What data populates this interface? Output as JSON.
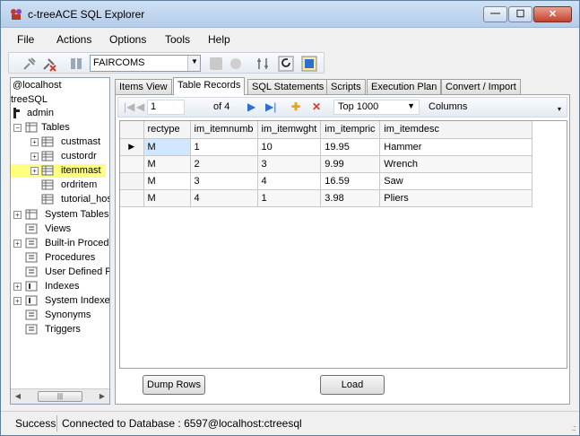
{
  "window": {
    "title": "c-treeACE SQL Explorer"
  },
  "menu": [
    "File",
    "Actions",
    "Options",
    "Tools",
    "Help"
  ],
  "toolbar": {
    "database": "FAIRCOMS"
  },
  "tree": {
    "server": "@localhost",
    "database": "treeSQL",
    "user": "admin",
    "tables_label": "Tables",
    "tables": [
      "custmast",
      "custordr",
      "itemmast",
      "ordritem",
      "tutorial_hos"
    ],
    "selected": "itemmast",
    "groups": [
      "System Tables",
      "Views",
      "Built-in Procedu",
      "Procedures",
      "User Defined F",
      "Indexes",
      "System Indexes",
      "Synonyms",
      "Triggers"
    ]
  },
  "tabs": [
    "Items View",
    "Table Records",
    "SQL Statements",
    "Scripts",
    "Execution Plan",
    "Convert / Import"
  ],
  "active_tab": "Table Records",
  "navigator": {
    "position": "1",
    "of_label": "of 4",
    "top_value": "Top 1000",
    "columns_label": "Columns"
  },
  "grid": {
    "columns": [
      "rectype",
      "im_itemnumb",
      "im_itemwght",
      "im_itempric",
      "im_itemdesc"
    ],
    "rows": [
      [
        "M",
        "1",
        "10",
        "19.95",
        "Hammer"
      ],
      [
        "M",
        "2",
        "3",
        "9.99",
        "Wrench"
      ],
      [
        "M",
        "3",
        "4",
        "16.59",
        "Saw"
      ],
      [
        "M",
        "4",
        "1",
        "3.98",
        "Pliers"
      ]
    ]
  },
  "buttons": {
    "dump": "Dump Rows",
    "load": "Load"
  },
  "status": {
    "state": "Success",
    "message": "Connected to Database : 6597@localhost:ctreesql"
  },
  "icons": {
    "app": "app-icon",
    "minimize": "minimize-icon",
    "maximize": "maximize-icon",
    "close": "close-icon",
    "first": "first-record-icon",
    "prev": "previous-record-icon",
    "next": "next-record-icon",
    "last": "last-record-icon",
    "add": "add-record-icon",
    "delete": "delete-record-icon"
  },
  "colors": {
    "selection": "#ffff80",
    "accent": "#2c6fce",
    "delete": "#d23a2a",
    "add": "#e8a317"
  }
}
